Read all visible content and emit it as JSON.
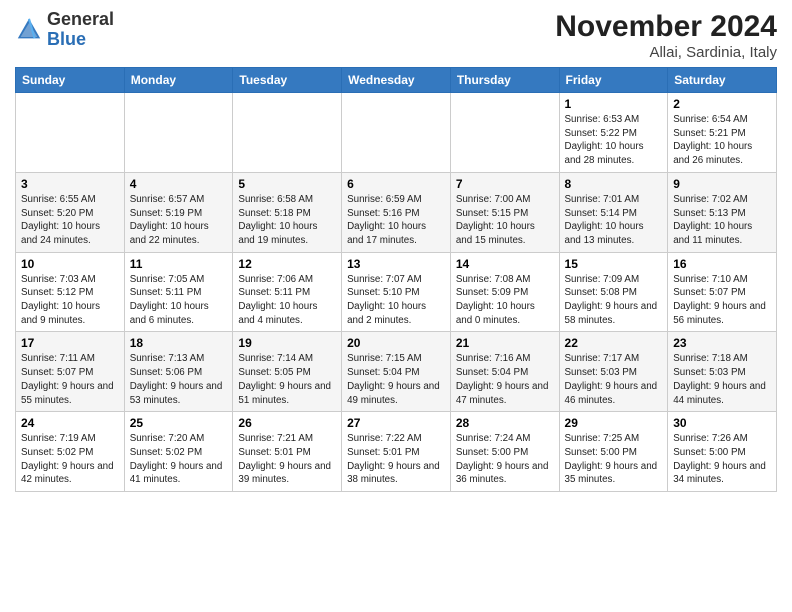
{
  "header": {
    "logo_general": "General",
    "logo_blue": "Blue",
    "month_title": "November 2024",
    "location": "Allai, Sardinia, Italy"
  },
  "days_of_week": [
    "Sunday",
    "Monday",
    "Tuesday",
    "Wednesday",
    "Thursday",
    "Friday",
    "Saturday"
  ],
  "weeks": [
    [
      {
        "day": "",
        "info": ""
      },
      {
        "day": "",
        "info": ""
      },
      {
        "day": "",
        "info": ""
      },
      {
        "day": "",
        "info": ""
      },
      {
        "day": "",
        "info": ""
      },
      {
        "day": "1",
        "info": "Sunrise: 6:53 AM\nSunset: 5:22 PM\nDaylight: 10 hours and 28 minutes."
      },
      {
        "day": "2",
        "info": "Sunrise: 6:54 AM\nSunset: 5:21 PM\nDaylight: 10 hours and 26 minutes."
      }
    ],
    [
      {
        "day": "3",
        "info": "Sunrise: 6:55 AM\nSunset: 5:20 PM\nDaylight: 10 hours and 24 minutes."
      },
      {
        "day": "4",
        "info": "Sunrise: 6:57 AM\nSunset: 5:19 PM\nDaylight: 10 hours and 22 minutes."
      },
      {
        "day": "5",
        "info": "Sunrise: 6:58 AM\nSunset: 5:18 PM\nDaylight: 10 hours and 19 minutes."
      },
      {
        "day": "6",
        "info": "Sunrise: 6:59 AM\nSunset: 5:16 PM\nDaylight: 10 hours and 17 minutes."
      },
      {
        "day": "7",
        "info": "Sunrise: 7:00 AM\nSunset: 5:15 PM\nDaylight: 10 hours and 15 minutes."
      },
      {
        "day": "8",
        "info": "Sunrise: 7:01 AM\nSunset: 5:14 PM\nDaylight: 10 hours and 13 minutes."
      },
      {
        "day": "9",
        "info": "Sunrise: 7:02 AM\nSunset: 5:13 PM\nDaylight: 10 hours and 11 minutes."
      }
    ],
    [
      {
        "day": "10",
        "info": "Sunrise: 7:03 AM\nSunset: 5:12 PM\nDaylight: 10 hours and 9 minutes."
      },
      {
        "day": "11",
        "info": "Sunrise: 7:05 AM\nSunset: 5:11 PM\nDaylight: 10 hours and 6 minutes."
      },
      {
        "day": "12",
        "info": "Sunrise: 7:06 AM\nSunset: 5:11 PM\nDaylight: 10 hours and 4 minutes."
      },
      {
        "day": "13",
        "info": "Sunrise: 7:07 AM\nSunset: 5:10 PM\nDaylight: 10 hours and 2 minutes."
      },
      {
        "day": "14",
        "info": "Sunrise: 7:08 AM\nSunset: 5:09 PM\nDaylight: 10 hours and 0 minutes."
      },
      {
        "day": "15",
        "info": "Sunrise: 7:09 AM\nSunset: 5:08 PM\nDaylight: 9 hours and 58 minutes."
      },
      {
        "day": "16",
        "info": "Sunrise: 7:10 AM\nSunset: 5:07 PM\nDaylight: 9 hours and 56 minutes."
      }
    ],
    [
      {
        "day": "17",
        "info": "Sunrise: 7:11 AM\nSunset: 5:07 PM\nDaylight: 9 hours and 55 minutes."
      },
      {
        "day": "18",
        "info": "Sunrise: 7:13 AM\nSunset: 5:06 PM\nDaylight: 9 hours and 53 minutes."
      },
      {
        "day": "19",
        "info": "Sunrise: 7:14 AM\nSunset: 5:05 PM\nDaylight: 9 hours and 51 minutes."
      },
      {
        "day": "20",
        "info": "Sunrise: 7:15 AM\nSunset: 5:04 PM\nDaylight: 9 hours and 49 minutes."
      },
      {
        "day": "21",
        "info": "Sunrise: 7:16 AM\nSunset: 5:04 PM\nDaylight: 9 hours and 47 minutes."
      },
      {
        "day": "22",
        "info": "Sunrise: 7:17 AM\nSunset: 5:03 PM\nDaylight: 9 hours and 46 minutes."
      },
      {
        "day": "23",
        "info": "Sunrise: 7:18 AM\nSunset: 5:03 PM\nDaylight: 9 hours and 44 minutes."
      }
    ],
    [
      {
        "day": "24",
        "info": "Sunrise: 7:19 AM\nSunset: 5:02 PM\nDaylight: 9 hours and 42 minutes."
      },
      {
        "day": "25",
        "info": "Sunrise: 7:20 AM\nSunset: 5:02 PM\nDaylight: 9 hours and 41 minutes."
      },
      {
        "day": "26",
        "info": "Sunrise: 7:21 AM\nSunset: 5:01 PM\nDaylight: 9 hours and 39 minutes."
      },
      {
        "day": "27",
        "info": "Sunrise: 7:22 AM\nSunset: 5:01 PM\nDaylight: 9 hours and 38 minutes."
      },
      {
        "day": "28",
        "info": "Sunrise: 7:24 AM\nSunset: 5:00 PM\nDaylight: 9 hours and 36 minutes."
      },
      {
        "day": "29",
        "info": "Sunrise: 7:25 AM\nSunset: 5:00 PM\nDaylight: 9 hours and 35 minutes."
      },
      {
        "day": "30",
        "info": "Sunrise: 7:26 AM\nSunset: 5:00 PM\nDaylight: 9 hours and 34 minutes."
      }
    ]
  ]
}
